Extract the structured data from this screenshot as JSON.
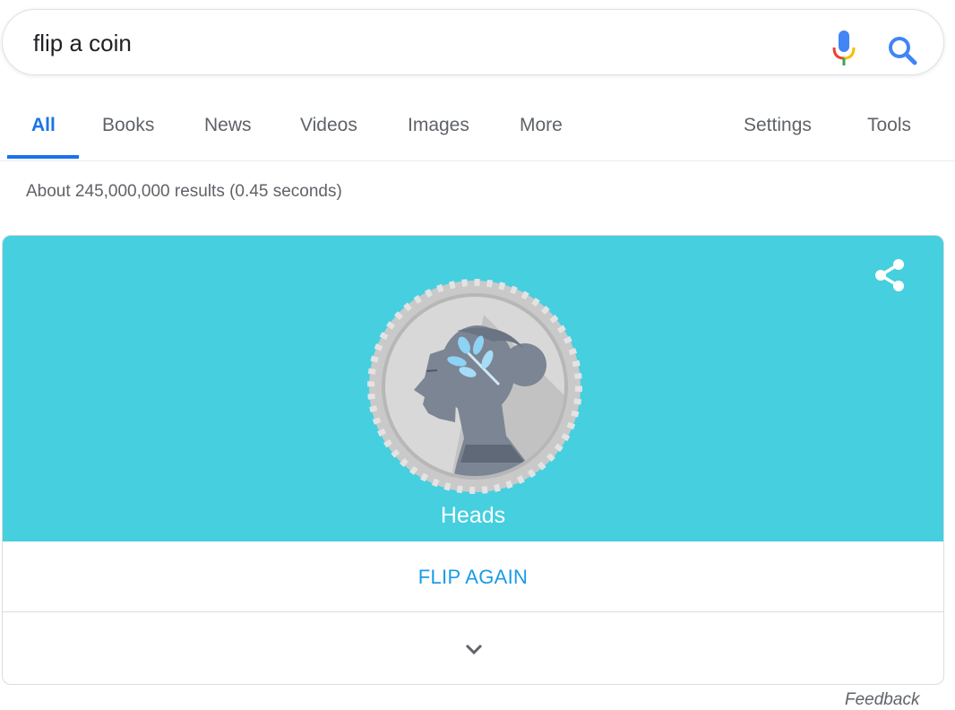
{
  "search": {
    "query": "flip a coin",
    "mic_icon": "mic-icon",
    "search_icon": "search-icon"
  },
  "tabs": {
    "items": [
      {
        "label": "All",
        "active": true
      },
      {
        "label": "Books"
      },
      {
        "label": "News"
      },
      {
        "label": "Videos"
      },
      {
        "label": "Images"
      },
      {
        "label": "More"
      }
    ],
    "right": [
      {
        "label": "Settings"
      },
      {
        "label": "Tools"
      }
    ]
  },
  "results": {
    "stats": "About 245,000,000 results (0.45 seconds)"
  },
  "coin_card": {
    "background": "#45cfdf",
    "share_icon": "share-icon",
    "coin_icon": "coin-heads-icon",
    "result": "Heads",
    "flip_label": "FLIP AGAIN",
    "expand_icon": "chevron-down-icon"
  },
  "footer": {
    "feedback": "Feedback"
  },
  "colors": {
    "accent": "#1a73e8",
    "link": "#1a9be8",
    "card": "#45cfdf"
  }
}
